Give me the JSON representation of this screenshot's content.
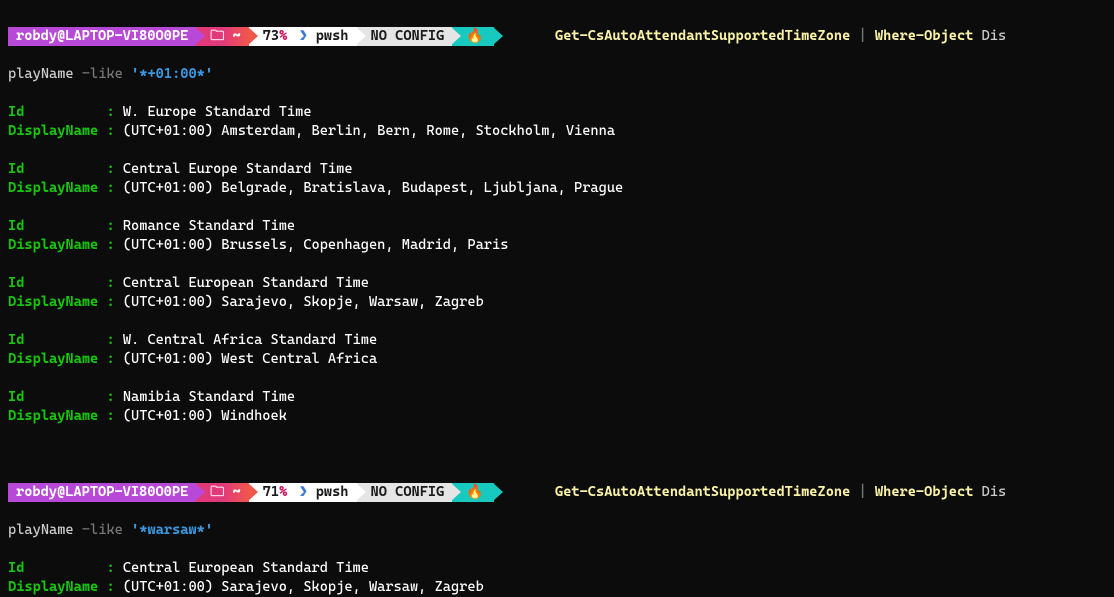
{
  "prompts": [
    {
      "user": "robdy@LAPTOP-VI80O0PE",
      "folder_icon": "🗀 ~",
      "battery": "73",
      "battery_pct": "%",
      "shell_arrow": "❯",
      "shell": "pwsh",
      "config": "NO CONFIG",
      "flame": "🔥",
      "cmd_cmdlet": "Get-CsAutoAttendantSupportedTimeZone",
      "cmd_pipe": " | ",
      "cmd_where": "Where-Object",
      "cmd_param_pre": " Dis",
      "wrap_param": "playName ",
      "wrap_op": "-like",
      "wrap_val": " '*+01:00*'"
    },
    {
      "user": "robdy@LAPTOP-VI80O0PE",
      "folder_icon": "🗀 ~",
      "battery": "71",
      "battery_pct": "%",
      "shell_arrow": "❯",
      "shell": "pwsh",
      "config": "NO CONFIG",
      "flame": "🔥",
      "cmd_cmdlet": "Get-CsAutoAttendantSupportedTimeZone",
      "cmd_pipe": " | ",
      "cmd_where": "Where-Object",
      "cmd_param_pre": " Dis",
      "wrap_param": "playName ",
      "wrap_op": "-like",
      "wrap_val": " '*warsaw*'"
    }
  ],
  "labels": {
    "id": "Id          : ",
    "dn": "DisplayName : "
  },
  "results1": [
    {
      "id": "W. Europe Standard Time",
      "dn": "(UTC+01:00) Amsterdam, Berlin, Bern, Rome, Stockholm, Vienna"
    },
    {
      "id": "Central Europe Standard Time",
      "dn": "(UTC+01:00) Belgrade, Bratislava, Budapest, Ljubljana, Prague"
    },
    {
      "id": "Romance Standard Time",
      "dn": "(UTC+01:00) Brussels, Copenhagen, Madrid, Paris"
    },
    {
      "id": "Central European Standard Time",
      "dn": "(UTC+01:00) Sarajevo, Skopje, Warsaw, Zagreb"
    },
    {
      "id": "W. Central Africa Standard Time",
      "dn": "(UTC+01:00) West Central Africa"
    },
    {
      "id": "Namibia Standard Time",
      "dn": "(UTC+01:00) Windhoek"
    }
  ],
  "results2": [
    {
      "id": "Central European Standard Time",
      "dn": "(UTC+01:00) Sarajevo, Skopje, Warsaw, Zagreb"
    }
  ]
}
